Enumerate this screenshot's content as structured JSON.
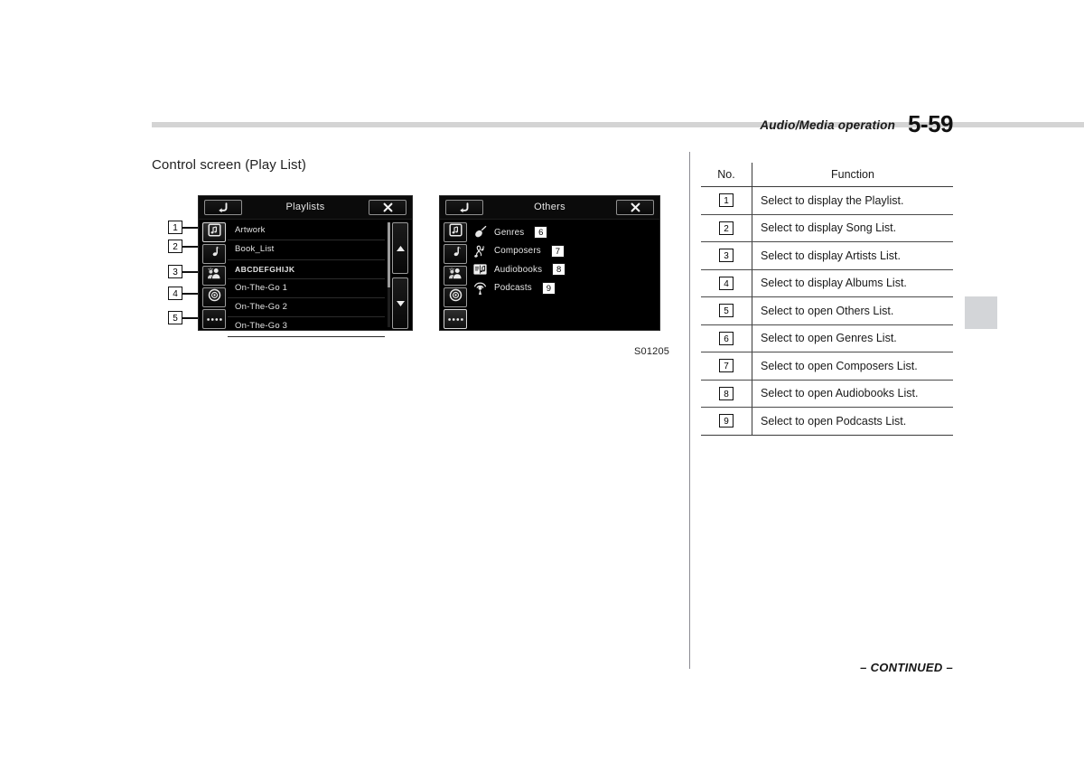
{
  "header": {
    "chapter_title": "Audio/Media operation",
    "page_number": "5-59",
    "footer_note": "– CONTINUED –"
  },
  "section": {
    "title": "Control screen (Play List)",
    "figure_id": "S01205"
  },
  "screens": [
    {
      "name": "playlists",
      "titlebar": {
        "back_icon": "back-arrow-icon",
        "title": "Playlists",
        "close_icon": "close-x-icon"
      },
      "rail": [
        {
          "icon": "playlist-note-square-icon",
          "callout": "1",
          "selected": true
        },
        {
          "icon": "music-note-icon",
          "callout": "2",
          "selected": false
        },
        {
          "icon": "artists-people-icon",
          "callout": "3",
          "selected": false
        },
        {
          "icon": "album-disc-icon",
          "callout": "4",
          "selected": false
        },
        {
          "icon": "others-ellipsis-icon",
          "callout": "5",
          "selected": false
        }
      ],
      "list_items": [
        "Artwork",
        "Book_List",
        "ABCDEFGHIJK",
        "On-The-Go 1",
        "On-The-Go 2",
        "On-The-Go 3"
      ],
      "scroll": {
        "up_icon": "scroll-up-arrow-icon",
        "down_icon": "scroll-down-arrow-icon"
      }
    },
    {
      "name": "others",
      "titlebar": {
        "back_icon": "back-arrow-icon",
        "title": "Others",
        "close_icon": "close-x-icon"
      },
      "rail": [
        {
          "icon": "playlist-note-square-icon",
          "selected": false
        },
        {
          "icon": "music-note-icon",
          "selected": false
        },
        {
          "icon": "artists-people-icon",
          "selected": false
        },
        {
          "icon": "album-disc-icon",
          "selected": false
        },
        {
          "icon": "others-ellipsis-icon",
          "selected": true
        }
      ],
      "menu_items": [
        {
          "icon": "genres-guitar-icon",
          "label": "Genres",
          "callout": "6"
        },
        {
          "icon": "composers-note-icon",
          "label": "Composers",
          "callout": "7"
        },
        {
          "icon": "audiobooks-book-icon",
          "label": "Audiobooks",
          "callout": "8"
        },
        {
          "icon": "podcasts-mic-icon",
          "label": "Podcasts",
          "callout": "9"
        }
      ]
    }
  ],
  "table": {
    "headers": {
      "no": "No.",
      "function": "Function"
    },
    "rows": [
      {
        "no": "1",
        "function": "Select to display the Playlist."
      },
      {
        "no": "2",
        "function": "Select to display Song List."
      },
      {
        "no": "3",
        "function": "Select to display Artists List."
      },
      {
        "no": "4",
        "function": "Select to display Albums List."
      },
      {
        "no": "5",
        "function": "Select to open Others List."
      },
      {
        "no": "6",
        "function": "Select to open Genres List."
      },
      {
        "no": "7",
        "function": "Select to open Composers List."
      },
      {
        "no": "8",
        "function": "Select to open Audiobooks List."
      },
      {
        "no": "9",
        "function": "Select to open Podcasts List."
      }
    ]
  },
  "colors": {
    "rule": "#d4d4d4",
    "screen_bg": "#000000",
    "tab_marker": "#d3d5d8"
  }
}
